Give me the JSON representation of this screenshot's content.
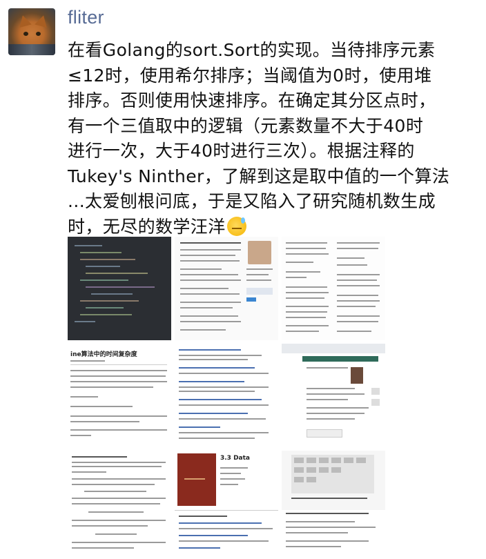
{
  "post": {
    "username": "fliter",
    "lines": [
      "在看Golang的sort.Sort的实现。当待排序元素",
      "≤12时，使用希尔排序；当阈值为0时，使用堆",
      "排序。否则使用快速排序。在确定其分区点时，",
      "有一个三值取中的逻辑（元素数量不大于40时",
      "进行一次，大于40时进行三次）。根据注释的",
      "Tukey's Ninther，了解到这是取中值的一个算法",
      "...太爱刨根问底，于是又陷入了研究随机数生成",
      "时，无尽的数学汪洋"
    ],
    "emoji": "sweat-smile-emoji"
  },
  "images": [
    {
      "kind": "code-editor"
    },
    {
      "kind": "article-profile"
    },
    {
      "kind": "paper-columns"
    },
    {
      "kind": "blog-article",
      "title": "ine算法中的时间复杂度"
    },
    {
      "kind": "search-results"
    },
    {
      "kind": "web-page"
    },
    {
      "kind": "paper-formula"
    },
    {
      "kind": "book-cover",
      "heading": "3.3 Data"
    },
    {
      "kind": "calculator-table"
    }
  ]
}
